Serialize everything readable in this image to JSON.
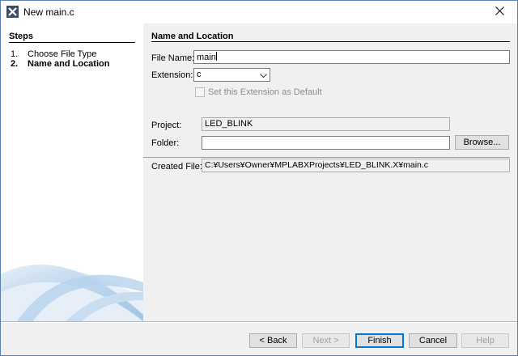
{
  "window": {
    "title": "New main.c",
    "app_icon": "netbeans-icon",
    "close_icon": "close-icon"
  },
  "steps": {
    "title": "Steps",
    "items": [
      {
        "number": "1.",
        "label": "Choose File Type"
      },
      {
        "number": "2.",
        "label": "Name and Location"
      }
    ]
  },
  "form": {
    "section_title": "Name and Location",
    "file_name_label": "File Name:",
    "file_name_value": "main",
    "extension_label": "Extension:",
    "extension_value": "c",
    "default_ext_label": "Set this Extension as Default",
    "project_label": "Project:",
    "project_value": "LED_BLINK",
    "folder_label": "Folder:",
    "folder_value": "",
    "browse_label": "Browse...",
    "created_file_label": "Created File:",
    "created_file_value": "C:¥Users¥Owner¥MPLABXProjects¥LED_BLINK.X¥main.c"
  },
  "buttons": {
    "back": "< Back",
    "next": "Next >",
    "finish": "Finish",
    "cancel": "Cancel",
    "help": "Help"
  },
  "colors": {
    "accent": "#0078d7",
    "swoosh": "#9fc3e6"
  }
}
